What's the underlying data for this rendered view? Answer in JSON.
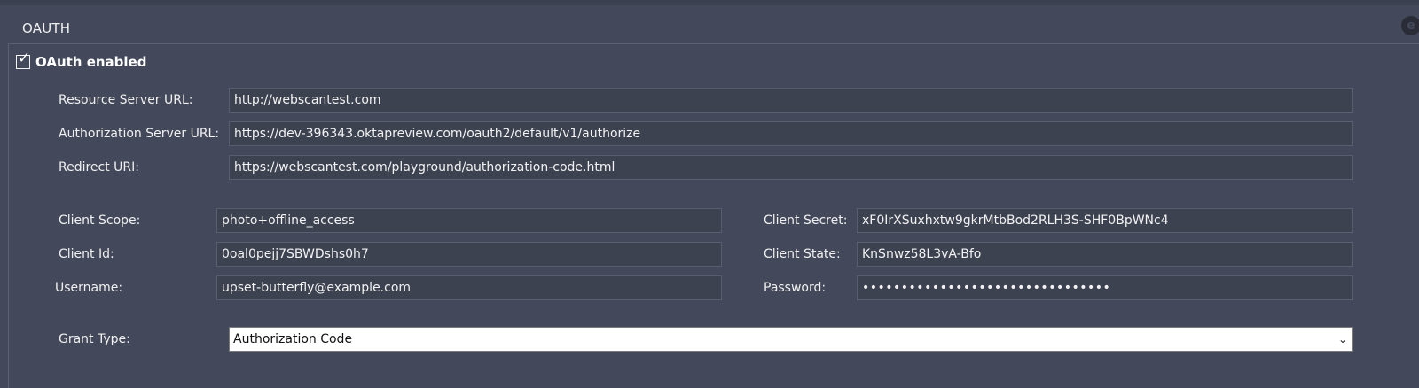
{
  "panel": {
    "title": "OAUTH"
  },
  "oauth_enabled": {
    "label": "OAuth enabled",
    "checked": true
  },
  "fields": {
    "resource_server_url": {
      "label": "Resource Server URL:",
      "value": "http://webscantest.com"
    },
    "authorization_server_url": {
      "label": "Authorization Server URL:",
      "value": "https://dev-396343.oktapreview.com/oauth2/default/v1/authorize"
    },
    "redirect_uri": {
      "label": "Redirect URI:",
      "value": "https://webscantest.com/playground/authorization-code.html"
    },
    "client_scope": {
      "label": "Client Scope:",
      "value": "photo+offline_access"
    },
    "client_secret": {
      "label": "Client Secret:",
      "value": "xF0IrXSuxhxtw9gkrMtbBod2RLH3S-SHF0BpWNc4"
    },
    "client_id": {
      "label": "Client Id:",
      "value": "0oal0pejj7SBWDshs0h7"
    },
    "client_state": {
      "label": "Client State:",
      "value": "KnSnwz58L3vA-Bfo"
    },
    "username": {
      "label": "Username:",
      "value": "upset-butterfly@example.com"
    },
    "password": {
      "label": "Password:",
      "value": "••••••••••••••••••••••••••••••••"
    },
    "grant_type": {
      "label": "Grant Type:",
      "value": "Authorization Code"
    }
  }
}
